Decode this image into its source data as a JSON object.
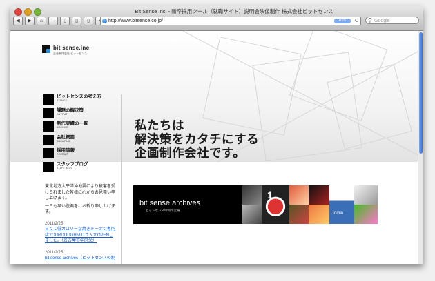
{
  "window": {
    "title": "Bit Sense Inc. - 新卒採用ツール（就職サイト）説明会映像制作 株式会社ビットセンス"
  },
  "toolbar": {
    "back_glyph": "◀",
    "forward_glyph": "▶",
    "home_glyph": "⌂",
    "minus_glyph": "–",
    "page_glyph": "▯",
    "bookmark_glyph": "▯",
    "reader_glyph": "▯",
    "add_glyph": "+",
    "url": "http://www.bitsense.co.jp/",
    "rss_badge": "RSS",
    "reload_glyph": "C",
    "search_placeholder": "Google"
  },
  "logo": {
    "main": "bit sense.inc.",
    "sub": "企画制作会社 ビットセンス"
  },
  "nav": [
    {
      "label": "ビットセンスの考え方",
      "sub": "STANCE"
    },
    {
      "label": "課題の解決策",
      "sub": "OUTPUT"
    },
    {
      "label": "制作実績の一覧",
      "sub": "ARCHIVE"
    },
    {
      "label": "会社概要",
      "sub": "ABOUT US"
    },
    {
      "label": "採用情報",
      "sub": "RECRUIT"
    },
    {
      "label": "スタッフブログ",
      "sub": "STAFF BLOG"
    }
  ],
  "hero": {
    "lines": [
      "私たちは",
      "解決策をカタチにする",
      "企画制作会社です。"
    ]
  },
  "news": {
    "notice": "東北地方太平洋沖地震により被害を受けられました皆様に心からお見舞い申し上げます。",
    "notice2": "一日も早い復興を、お祈り申し上げます。",
    "items": [
      {
        "date": "2011/2/25",
        "text": "甘くて低カロリーな焼きドーナツ専門店YOURDOUGHNUTさんがOPENしました。（名古屋市中区栄）"
      },
      {
        "date": "2011/2/25",
        "text": "bit sense archives（ビットセンスの制"
      }
    ]
  },
  "banner": {
    "title": "bit sense archives",
    "subtitle": "ビットセンスの制作実績"
  },
  "thumbs": {
    "number": "1",
    "label": "Tomio"
  }
}
